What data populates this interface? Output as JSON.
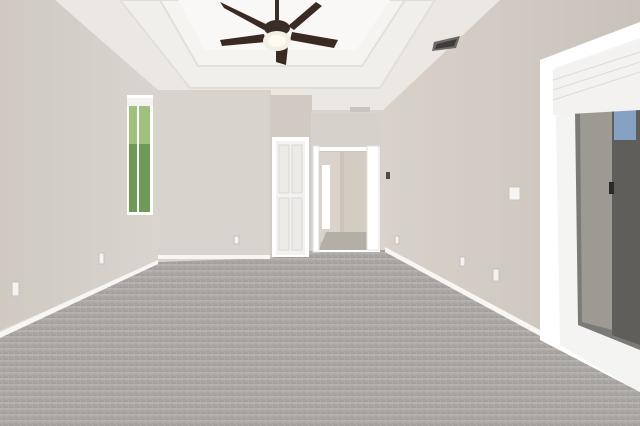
{
  "scene": {
    "colors": {
      "wall_left": "#d7d1ca",
      "wall_right": "#d3cdc5",
      "wall_back": "#d9d4cd",
      "ceiling": "#e9e6e1",
      "tray": "#f2f0ec",
      "carpet": "#a9a7a6",
      "trim": "#ffffff",
      "fan_blade": "#3b2a22",
      "outdoor_green": "#6f9b5a",
      "sky_blue": "#8fb3e0"
    },
    "icons": [
      "ceiling-fan-icon",
      "window-icon",
      "door-icon",
      "outlet-icon",
      "light-switch-icon",
      "vent-icon",
      "sliding-door-icon"
    ]
  }
}
